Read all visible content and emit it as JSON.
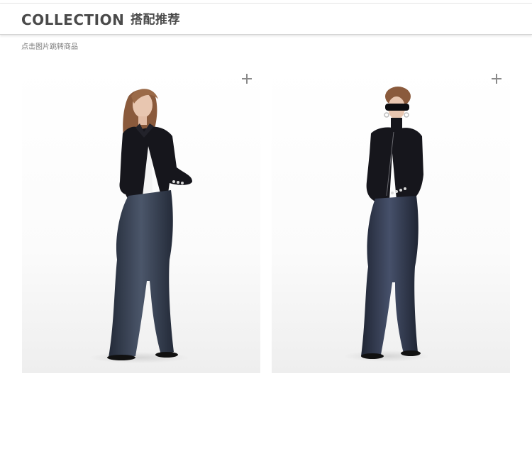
{
  "header": {
    "title_en": "COLLECTION",
    "title_cn": "搭配推荐"
  },
  "hint": "点击图片跳转商品",
  "products": [
    {
      "image_icon": "model-photo-icon",
      "plus_icon": "plus-icon"
    },
    {
      "image_icon": "model-photo-icon",
      "plus_icon": "plus-icon"
    }
  ],
  "colors": {
    "title": "#4a4a4a",
    "hint": "#7a7a7a",
    "plus": "#8a8a8a",
    "jacket": "#16161c",
    "denim": "#2c3444",
    "denim_light": "#4b566a",
    "hair": "#8a5a3c",
    "skin": "#e8c6b0"
  }
}
